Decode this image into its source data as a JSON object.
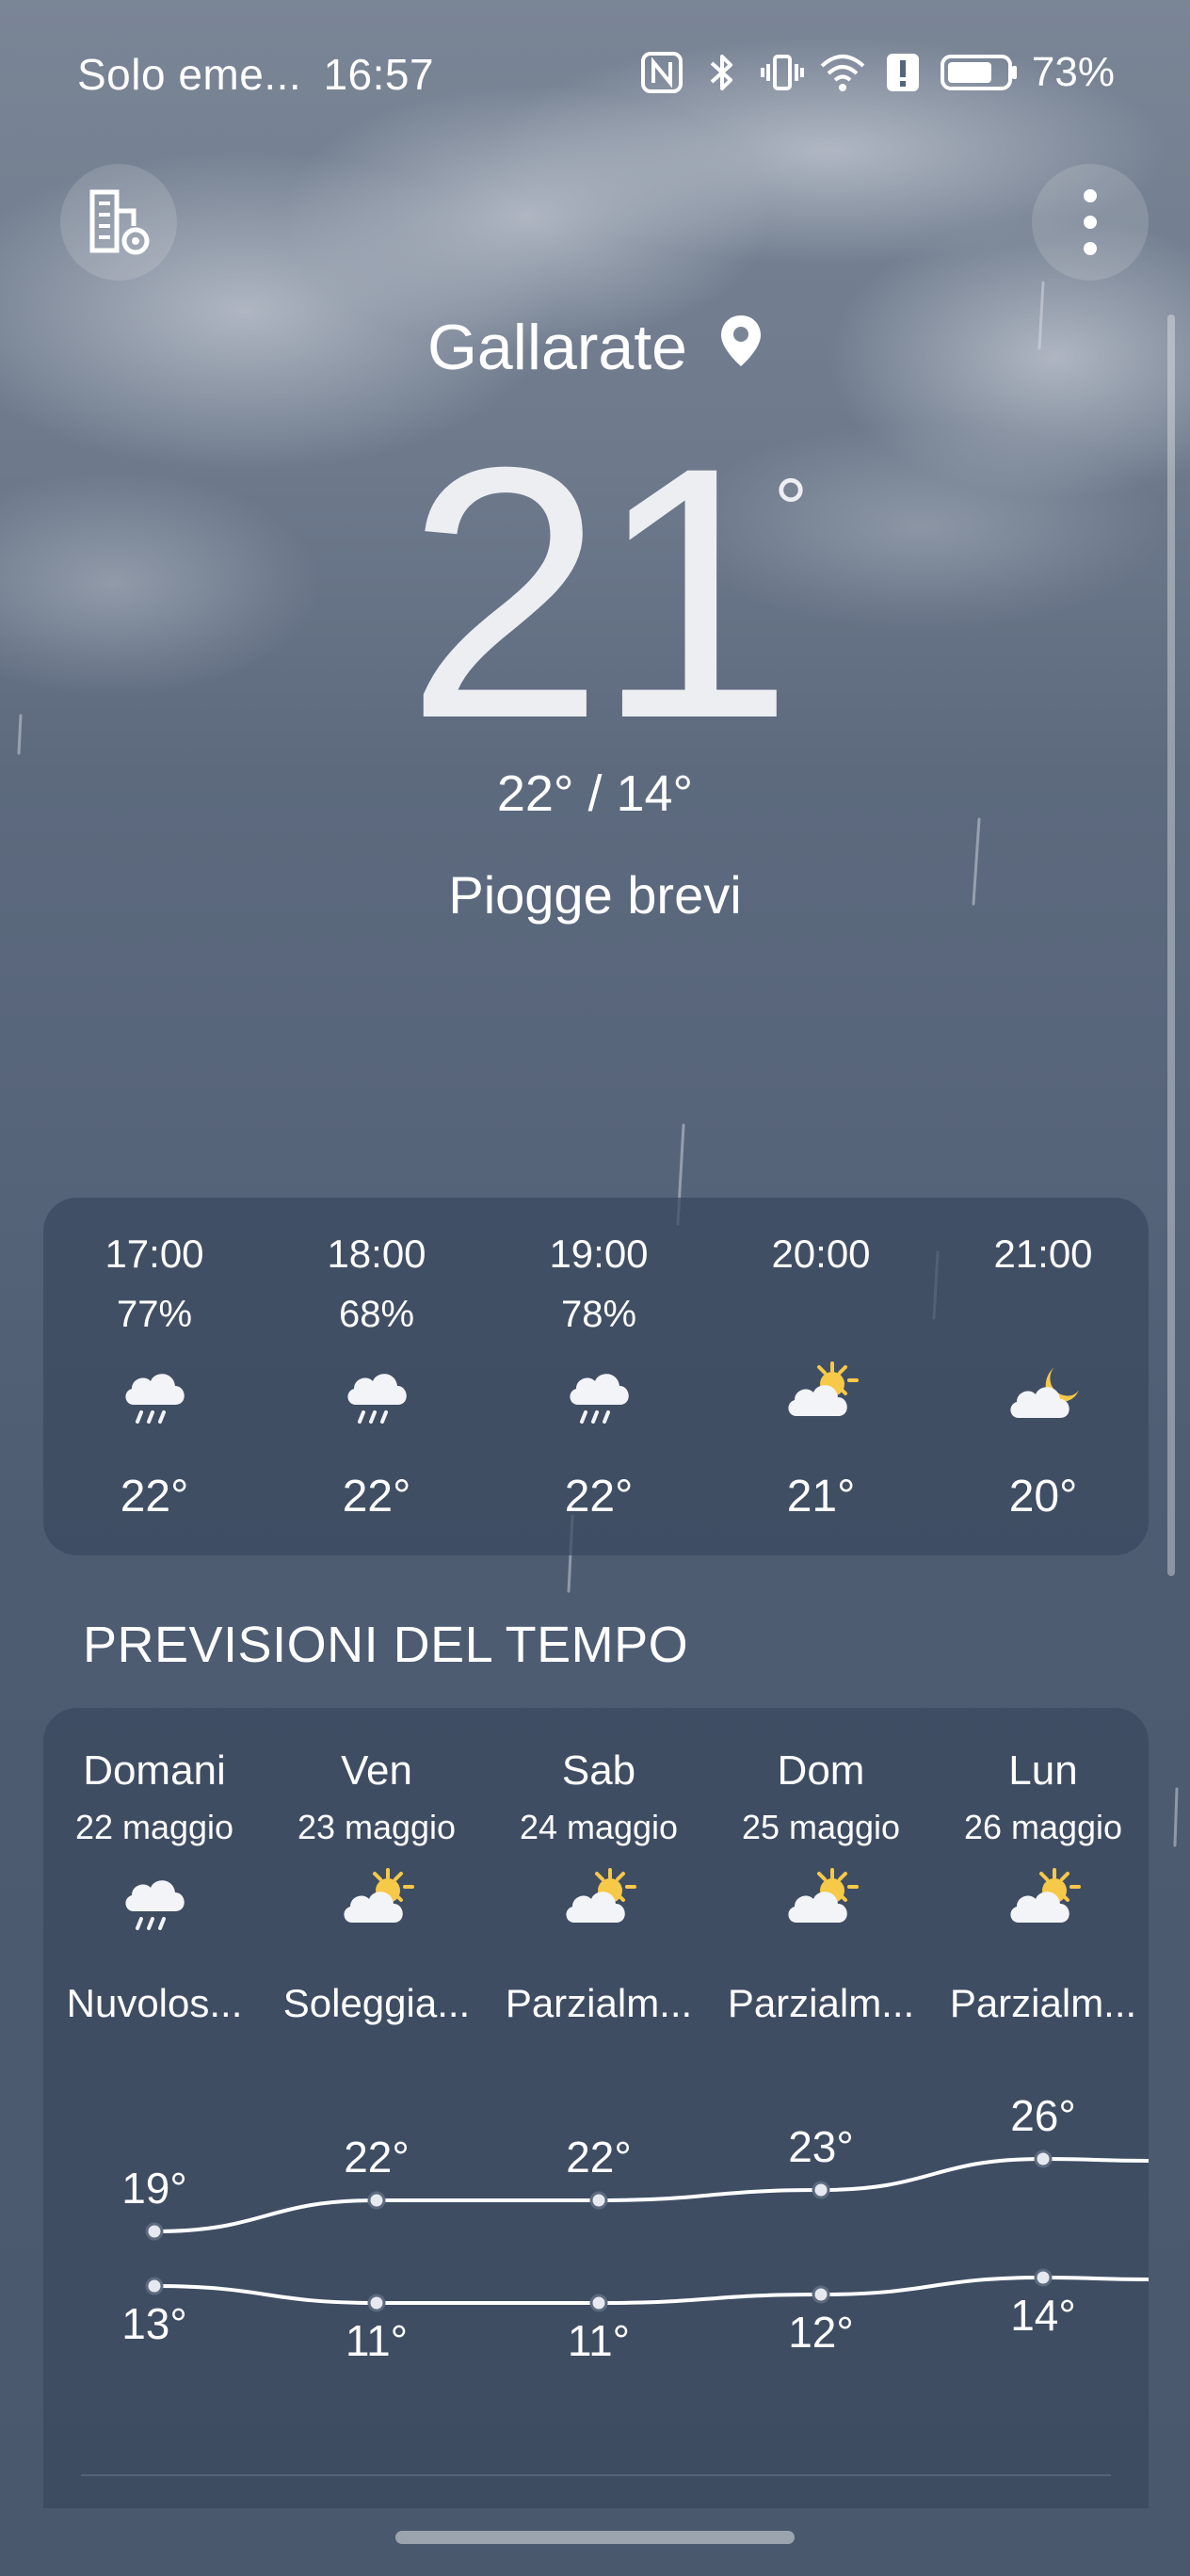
{
  "status_bar": {
    "carrier": "Solo eme...",
    "time": "16:57",
    "battery": "73%",
    "icons": [
      "nfc-icon",
      "bluetooth-icon",
      "vibrate-icon",
      "wifi-icon",
      "alert-icon",
      "battery-icon"
    ]
  },
  "header": {
    "left_button_icon": "city-settings-icon",
    "right_button_icon": "more-vertical-icon"
  },
  "current": {
    "city": "Gallarate",
    "temperature": "21",
    "degree": "°",
    "range": "22° / 14°",
    "condition": "Piogge brevi"
  },
  "hourly": [
    {
      "time": "17:00",
      "precip": "77%",
      "icon": "rain-cloud-icon",
      "temp": "22°"
    },
    {
      "time": "18:00",
      "precip": "68%",
      "icon": "rain-cloud-icon",
      "temp": "22°"
    },
    {
      "time": "19:00",
      "precip": "78%",
      "icon": "rain-cloud-icon",
      "temp": "22°"
    },
    {
      "time": "20:00",
      "precip": "",
      "icon": "partly-sunny-icon",
      "temp": "21°"
    },
    {
      "time": "21:00",
      "precip": "",
      "icon": "night-cloud-icon",
      "temp": "20°"
    }
  ],
  "forecast": {
    "title": "PREVISIONI DEL TEMPO",
    "days": [
      {
        "day": "Domani",
        "date": "22 maggio",
        "icon": "rain-cloud-icon",
        "condition": "Nuvolos..."
      },
      {
        "day": "Ven",
        "date": "23 maggio",
        "icon": "partly-sunny-icon",
        "condition": "Soleggia..."
      },
      {
        "day": "Sab",
        "date": "24 maggio",
        "icon": "partly-sunny-icon",
        "condition": "Parzialm..."
      },
      {
        "day": "Dom",
        "date": "25 maggio",
        "icon": "partly-sunny-icon",
        "condition": "Parzialm..."
      },
      {
        "day": "Lun",
        "date": "26 maggio",
        "icon": "partly-sunny-icon",
        "condition": "Parzialm..."
      }
    ],
    "chart_data": {
      "type": "line",
      "categories": [
        "Domani",
        "Ven",
        "Sab",
        "Dom",
        "Lun"
      ],
      "series": [
        {
          "values": [
            19,
            22,
            22,
            23,
            26
          ],
          "labels": [
            "19°",
            "22°",
            "22°",
            "23°",
            "26°"
          ]
        },
        {
          "values": [
            13,
            11,
            11,
            12,
            14
          ],
          "labels": [
            "13°",
            "11°",
            "11°",
            "12°",
            "14°"
          ]
        }
      ]
    }
  },
  "colors": {
    "sun": "#f7c948",
    "cloud": "#f2f4f7",
    "card": "#3a485e"
  }
}
